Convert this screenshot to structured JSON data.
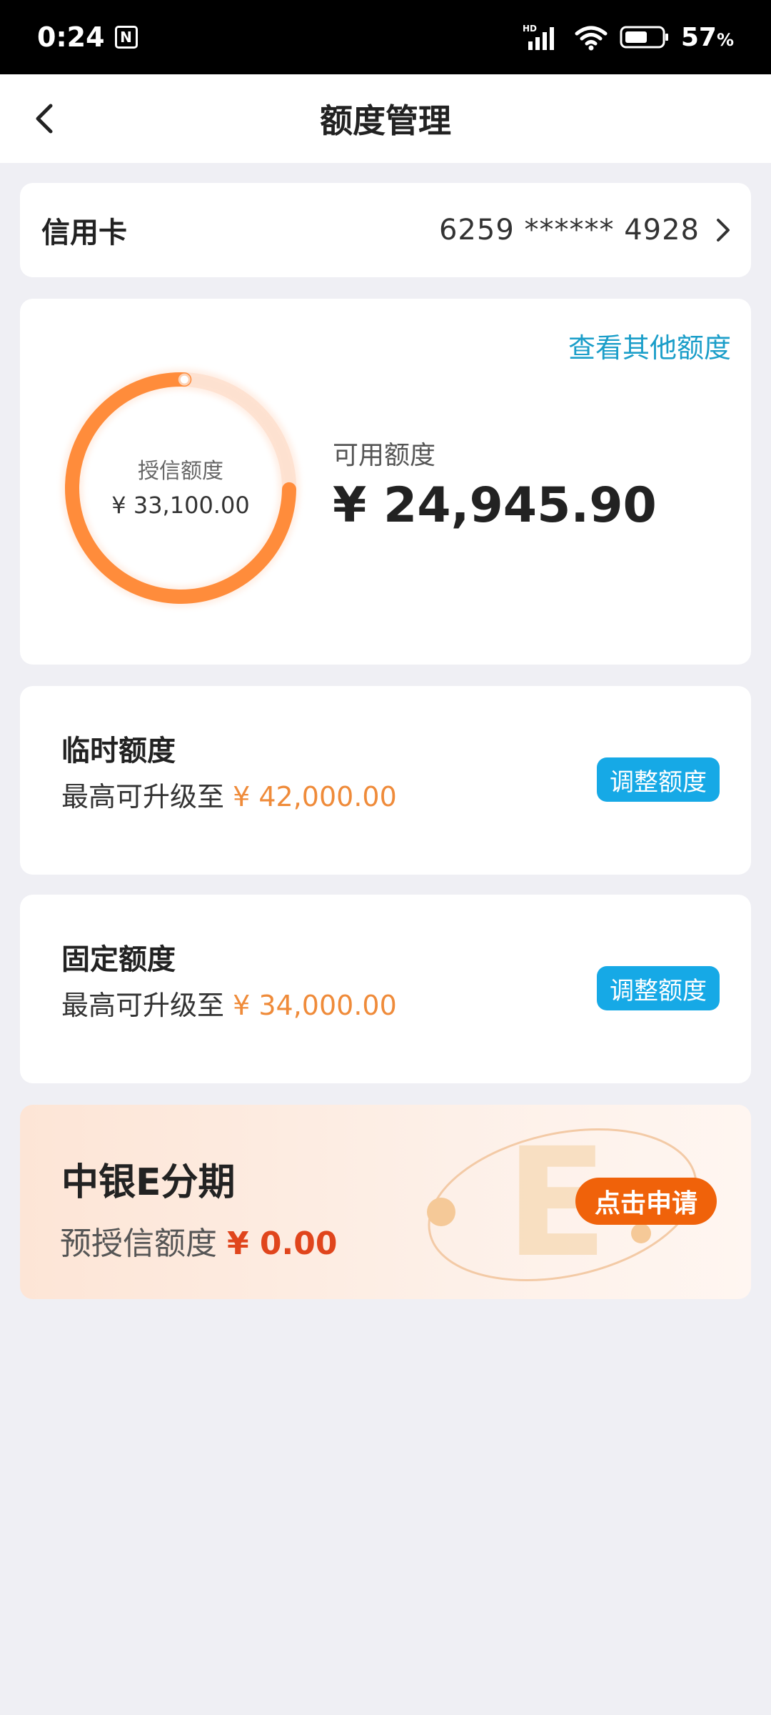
{
  "status": {
    "time": "0:24",
    "nfc": "N",
    "network": "HD",
    "battery": "57",
    "battery_unit": "%"
  },
  "nav": {
    "title": "额度管理"
  },
  "card_row": {
    "type": "信用卡",
    "number": "6259 ****** 4928"
  },
  "credit": {
    "other_link": "查看其他额度",
    "total_label": "授信额度",
    "total_value": "¥ 33,100.00",
    "available_label": "可用额度",
    "available_value": "¥ 24,945.90",
    "available_fraction": 0.7536
  },
  "temp_limit": {
    "title": "临时额度",
    "sub_prefix": "最高可升级至",
    "amount": "¥ 42,000.00",
    "button": "调整额度"
  },
  "fixed_limit": {
    "title": "固定额度",
    "sub_prefix": "最高可升级至",
    "amount": "¥ 34,000.00",
    "button": "调整额度"
  },
  "e_installment": {
    "title": "中银E分期",
    "sub_prefix": "预授信额度",
    "amount": "¥ 0.00",
    "button": "点击申请"
  },
  "colors": {
    "accent_blue": "#16a9e6",
    "ring_orange": "#ff8c3b",
    "amount_orange": "#ef8b3a",
    "apply_orange": "#f0620a"
  },
  "icons": {
    "back": "chevron-left-icon",
    "card_arrow": "chevron-right-icon",
    "signal": "signal-icon",
    "wifi": "wifi-icon",
    "battery": "battery-icon"
  }
}
